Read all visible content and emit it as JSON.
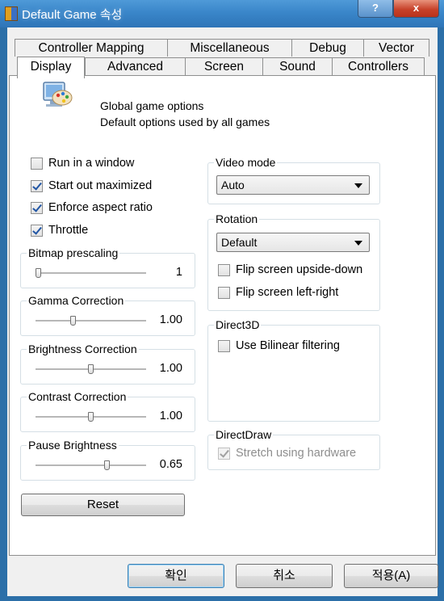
{
  "window": {
    "title": "Default Game 속성",
    "help_label": "?",
    "close_label": "x"
  },
  "tabs": {
    "row1": [
      "Controller Mapping",
      "Miscellaneous",
      "Debug",
      "Vector"
    ],
    "row2": [
      "Advanced",
      "Screen",
      "Sound",
      "Controllers"
    ],
    "active": "Display"
  },
  "header": {
    "line1": "Global game options",
    "line2": "Default options used by all games"
  },
  "checkboxes": {
    "run_in_window": {
      "label": "Run in a window",
      "checked": false
    },
    "start_maximized": {
      "label": "Start out maximized",
      "checked": true
    },
    "enforce_aspect": {
      "label": "Enforce aspect ratio",
      "checked": true
    },
    "throttle": {
      "label": "Throttle",
      "checked": true
    }
  },
  "sliders": {
    "bitmap_prescaling": {
      "label": "Bitmap prescaling",
      "value": "1",
      "level": 0.0
    },
    "gamma": {
      "label": "Gamma Correction",
      "value": "1.00",
      "level": 0.33
    },
    "brightness": {
      "label": "Brightness Correction",
      "value": "1.00",
      "level": 0.5
    },
    "contrast": {
      "label": "Contrast Correction",
      "value": "1.00",
      "level": 0.5
    },
    "pause_brightness": {
      "label": "Pause Brightness",
      "value": "0.65",
      "level": 0.65
    }
  },
  "reset_label": "Reset",
  "video_mode": {
    "label": "Video mode",
    "selected": "Auto"
  },
  "rotation": {
    "label": "Rotation",
    "selected": "Default",
    "flip_upside_down": {
      "label": "Flip screen upside-down",
      "checked": false
    },
    "flip_left_right": {
      "label": "Flip screen left-right",
      "checked": false
    }
  },
  "direct3d": {
    "label": "Direct3D",
    "bilinear": {
      "label": "Use Bilinear filtering",
      "checked": false
    }
  },
  "directdraw": {
    "label": "DirectDraw",
    "stretch": {
      "label": "Stretch using hardware",
      "checked": true,
      "disabled": true
    }
  },
  "footer": {
    "ok": "확인",
    "cancel": "취소",
    "apply": "적용(A)"
  },
  "colors": {
    "titlebar": "#3a86c9",
    "close": "#c7422a",
    "panel": "#ffffff",
    "dialog": "#f0f0f0"
  }
}
